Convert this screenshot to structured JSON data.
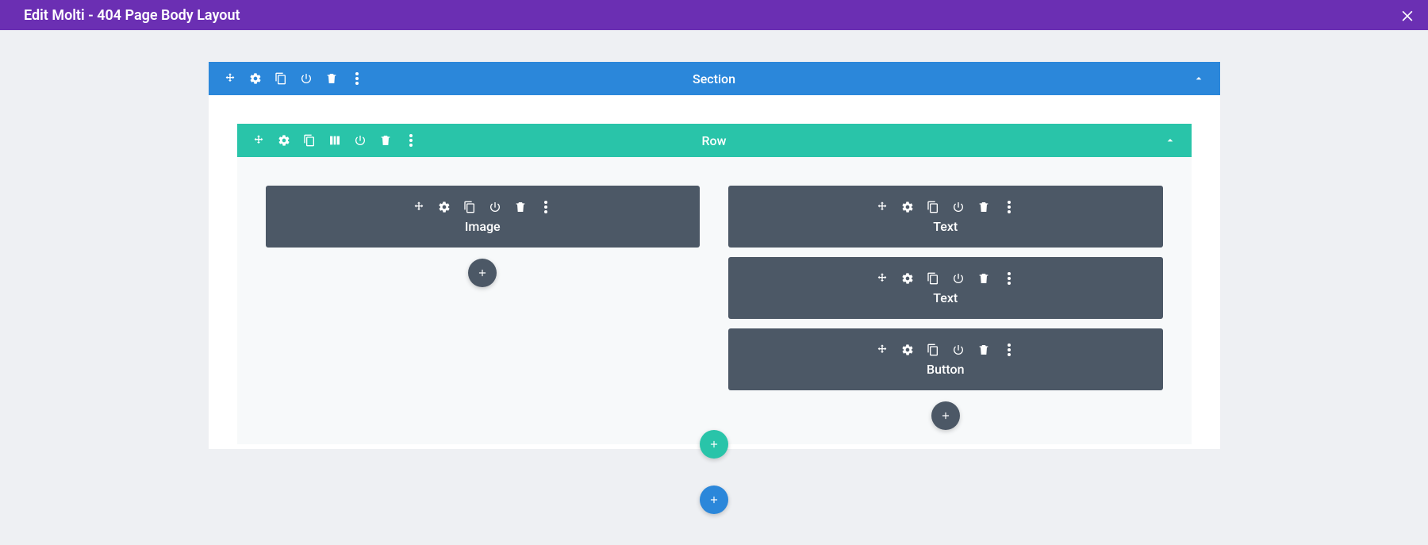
{
  "header": {
    "title": "Edit Molti - 404 Page Body Layout"
  },
  "section": {
    "label": "Section",
    "row": {
      "label": "Row",
      "columns": [
        {
          "modules": [
            {
              "label": "Image"
            }
          ]
        },
        {
          "modules": [
            {
              "label": "Text"
            },
            {
              "label": "Text"
            },
            {
              "label": "Button"
            }
          ]
        }
      ]
    }
  }
}
